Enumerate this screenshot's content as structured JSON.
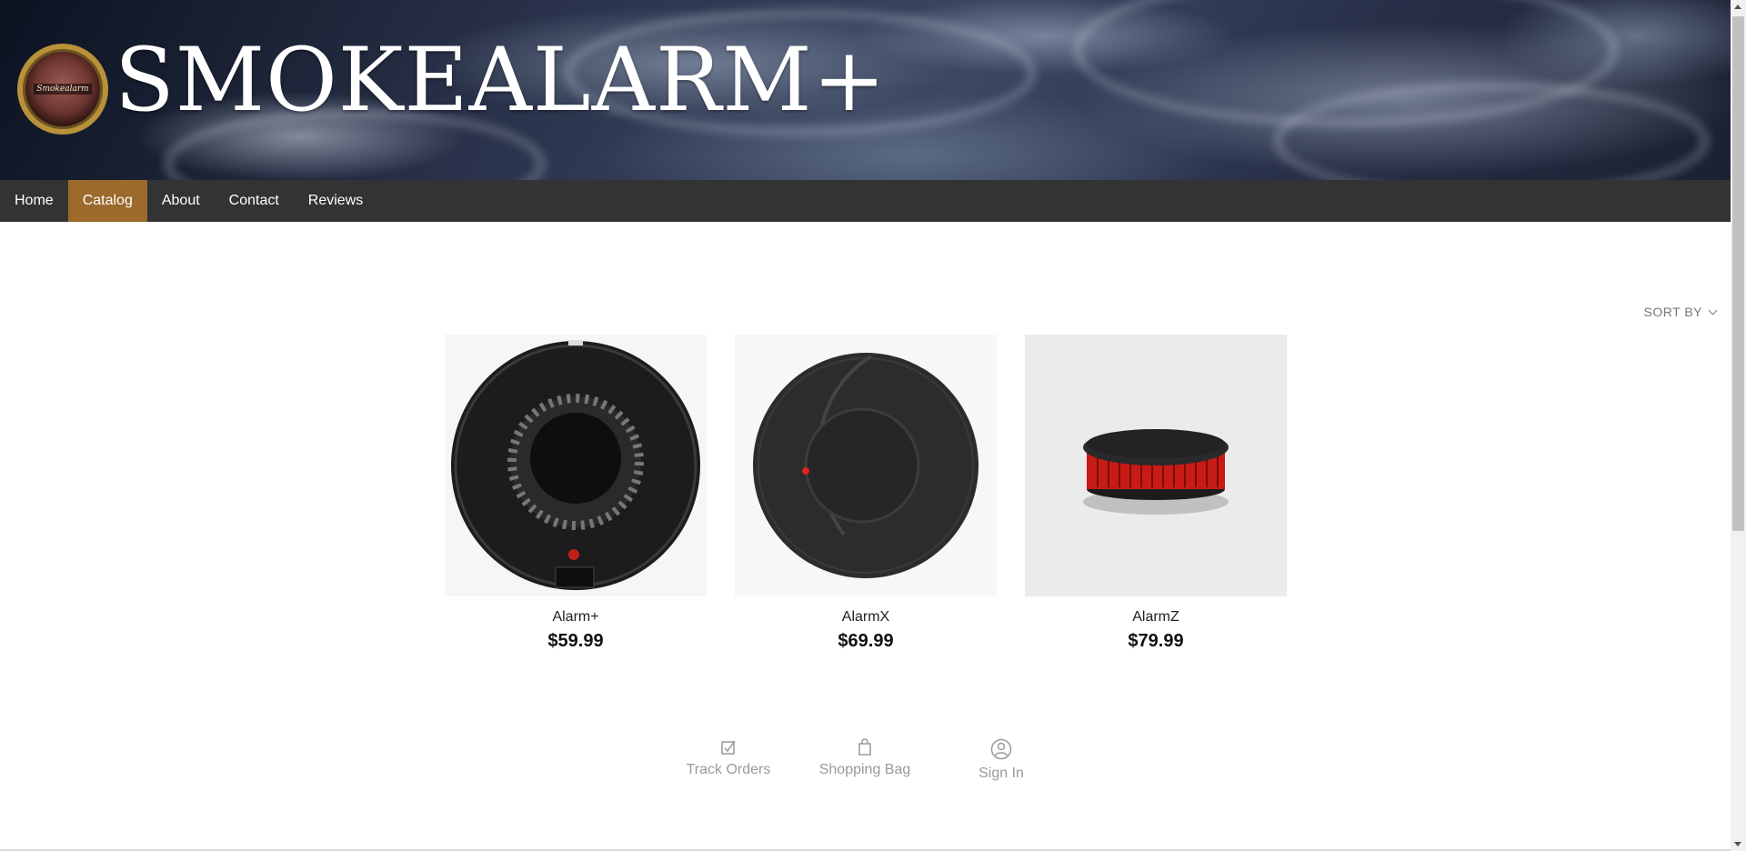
{
  "header": {
    "title": "SMOKEALARM+",
    "logo_text": "Smokealarm"
  },
  "nav": {
    "items": [
      "Home",
      "Catalog",
      "About",
      "Contact",
      "Reviews"
    ],
    "active": "Catalog"
  },
  "sort": {
    "label": "SORT BY"
  },
  "products": [
    {
      "name": "Alarm+",
      "price": "$59.99"
    },
    {
      "name": "AlarmX",
      "price": "$69.99"
    },
    {
      "name": "AlarmZ",
      "price": "$79.99"
    }
  ],
  "footer": {
    "links": [
      {
        "label": "Track Orders",
        "icon": "track-orders-icon"
      },
      {
        "label": "Shopping Bag",
        "icon": "shopping-bag-icon"
      },
      {
        "label": "Sign In",
        "icon": "user-icon"
      }
    ]
  },
  "colors": {
    "nav_bg": "#333333",
    "nav_active": "#9b6a2c",
    "price_text": "#111111"
  }
}
